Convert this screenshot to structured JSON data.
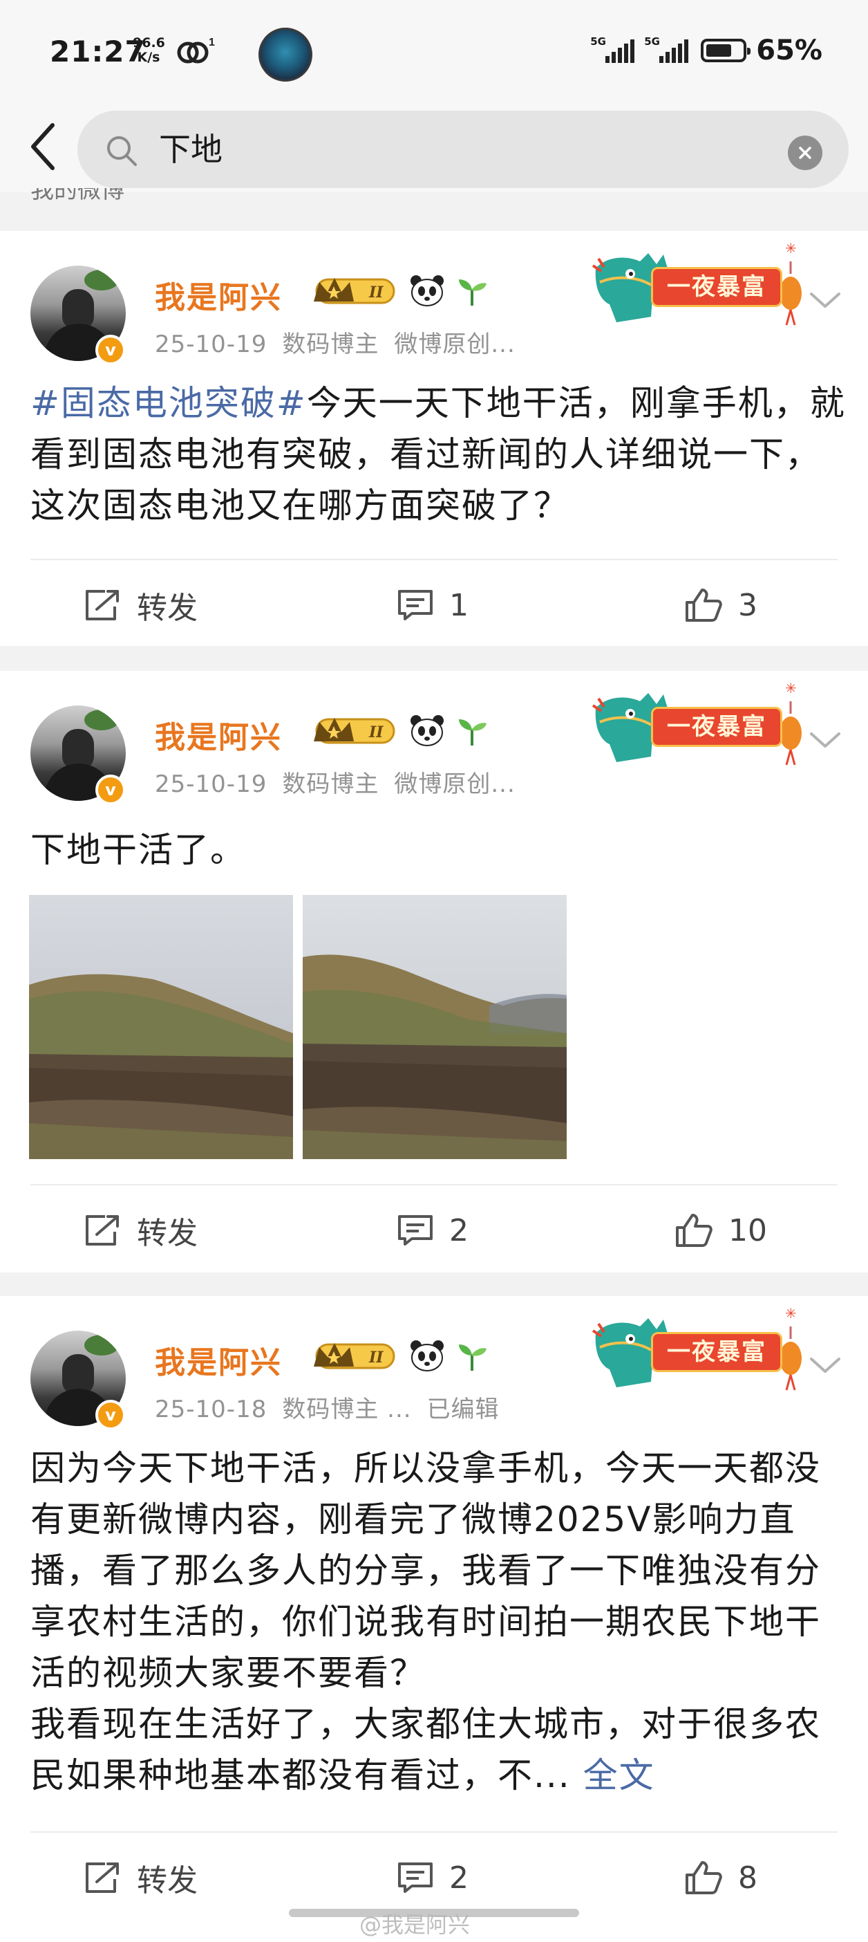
{
  "status_bar": {
    "time": "21:27",
    "net_speed_value": "96.6",
    "net_speed_unit": "K/s",
    "network_badge": "1",
    "signal1": "5G",
    "signal2": "5G",
    "battery_percent": "65%",
    "battery_level": 0.65
  },
  "search": {
    "query": "下地"
  },
  "section_label": "我的微博",
  "posts": [
    {
      "username": "我是阿兴",
      "date": "25-10-19",
      "role": "数码博主",
      "extra": "微博原创...",
      "banner": "一夜暴富",
      "topic": "#固态电池突破#",
      "text": "今天一天下地干活，刚拿手机，就看到固态电池有突破，看过新闻的人详细说一下，这次固态电池又在哪方面突破了？",
      "repost_label": "转发",
      "comments": "1",
      "likes": "3"
    },
    {
      "username": "我是阿兴",
      "date": "25-10-19",
      "role": "数码博主",
      "extra": "微博原创...",
      "banner": "一夜暴富",
      "text": "下地干活了。",
      "repost_label": "转发",
      "comments": "2",
      "likes": "10"
    },
    {
      "username": "我是阿兴",
      "date": "25-10-18",
      "role": "数码博主 ...",
      "extra": "已编辑",
      "banner": "一夜暴富",
      "text": "因为今天下地干活，所以没拿手机，今天一天都没有更新微博内容，刚看完了微博2025V影响力直播，看了那么多人的分享，我看了一下唯独没有分享农村生活的，你们说我有时间拍一期农民下地干活的视频大家要不要看？",
      "text2": "我看现在生活好了，大家都住大城市，对于很多农民如果种地基本都没有看过，不...",
      "full_link": "全文",
      "repost_label": "转发",
      "comments": "2",
      "likes": "8"
    }
  ],
  "watermark": "@我是阿兴",
  "colors": {
    "username": "#e8761f",
    "topic_link": "#4a6aa5",
    "meta": "#939393",
    "page_bg": "#f2f2f2"
  }
}
